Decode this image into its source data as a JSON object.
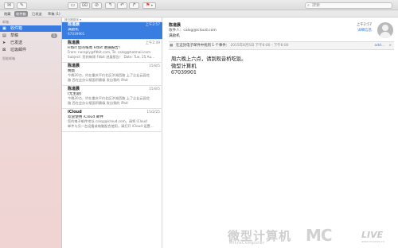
{
  "toolbar": {
    "buttons": [
      "envelope-icon",
      "compose-icon",
      "archive-icon",
      "trash-icon",
      "junk-icon",
      "reply-icon",
      "reply-all-icon",
      "forward-icon",
      "flag-icon"
    ],
    "search_placeholder": "搜索"
  },
  "favorites": {
    "hide": "隐藏",
    "items": [
      "收件箱",
      "已发送",
      "草稿 (1)"
    ]
  },
  "sidebar": {
    "mailbox_header": "邮箱",
    "items": [
      {
        "label": "收件箱",
        "count": "",
        "selected": true
      },
      {
        "label": "草稿",
        "count": "1",
        "selected": false
      },
      {
        "label": "已发送",
        "count": "",
        "selected": false
      },
      {
        "label": "垃圾邮件",
        "count": "",
        "selected": false
      }
    ],
    "smart_header": "智能邮箱"
  },
  "list": {
    "sort_label": "按日期排序 ▾",
    "messages": [
      {
        "from": "陈道晨",
        "date": "上午2:57",
        "subject": "满励机",
        "preview": "67039901",
        "selected": true
      },
      {
        "from": "陈道晨",
        "date": "上午2:49",
        "subject": "Fitbit 您的每周 Fitbit 进展报告！",
        "preview": "From: noreply@fitbit.com, To: calsg@hotmail.com",
        "preview2": "Subject: 您的每周 Fitbit 进展报告！ Date: Tue, 25 Au...",
        "selected": false
      },
      {
        "from": "陈道晨",
        "date": "15/8/5",
        "subject": "晚饭",
        "preview": "今晚20点，约在重庆平价北区洪湖西路 上了企业云园北",
        "preview2": "路 西在会办公楼面积最级 发自我的 iPad",
        "selected": false
      },
      {
        "from": "陈道晨",
        "date": "15/8/5",
        "subject": "(无主题)",
        "preview": "今晚20点，约在重庆平价北区洪湖西路 上了企业云园北",
        "preview2": "路 西在会办公楼面积最级 发自我的 iPad",
        "selected": false
      },
      {
        "from": "iCloud",
        "date": "15/2/25",
        "subject": "欢迎使用 iCloud 邮件",
        "preview": "您的电子邮件地址 calsg@icloud.com。请将 iCloud",
        "preview2": "邮件与另一台设备或电脑配合使用，请打开 iCloud 设置...",
        "selected": false
      }
    ]
  },
  "reader": {
    "from": "陈道晨",
    "to_label": "收件人：",
    "to_value": "calsg@icloud.com",
    "subject": "满励机",
    "date": "上午2:57",
    "details": "详细信息",
    "calendar": "在这封电子邮件中找到 1 个事件：",
    "calendar_detail": "2015年8月5日 下午6:00 - 下午6:00",
    "calendar_add": "add...",
    "body": [
      "周六晚上六点，请到观音桥吃饭。",
      "微型计算机",
      "67039901"
    ]
  },
  "watermark": {
    "cn": "微型计算机",
    "en": "MicroComputer",
    "logo": "MC",
    "live": "LIVE",
    "url": "www.mcplive.cn"
  }
}
